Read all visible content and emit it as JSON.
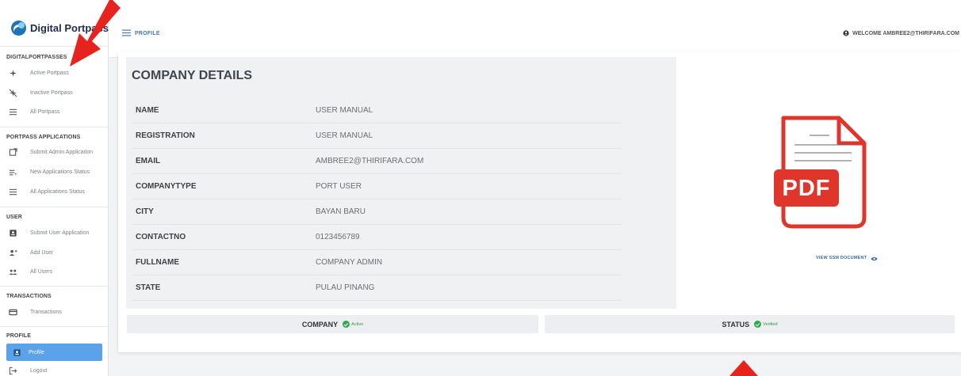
{
  "app": {
    "brand": "Digital Portpass",
    "brand_color": "#1f74b7"
  },
  "topbar": {
    "breadcrumb": "PROFILE",
    "welcome": "WELCOME AMBREE2@THIRIFARA.COM"
  },
  "sidebar": {
    "sections": [
      {
        "heading": "DIGITALPORTPASSES",
        "items": [
          {
            "label": "Active Portpass",
            "icon": "plane-icon"
          },
          {
            "label": "Inactive Portpass",
            "icon": "plane-off-icon"
          },
          {
            "label": "All Portpass",
            "icon": "list-icon"
          }
        ]
      },
      {
        "heading": "PORTPASS APPLICATIONS",
        "items": [
          {
            "label": "Submit Admin Application",
            "icon": "form-icon"
          },
          {
            "label": "New Applications Status",
            "icon": "new-list-icon"
          },
          {
            "label": "All Applications Status",
            "icon": "list-icon"
          }
        ]
      },
      {
        "heading": "USER",
        "items": [
          {
            "label": "Submit User Application",
            "icon": "id-badge-icon"
          },
          {
            "label": "Add User",
            "icon": "add-user-icon"
          },
          {
            "label": "All Users",
            "icon": "users-icon"
          }
        ]
      },
      {
        "heading": "TRANSACTIONS",
        "items": [
          {
            "label": "Transactions",
            "icon": "card-icon"
          }
        ]
      },
      {
        "heading": "PROFILE",
        "items": [
          {
            "label": "Profile",
            "icon": "profile-icon",
            "active": true
          },
          {
            "label": "Logout",
            "icon": "logout-icon"
          }
        ]
      }
    ],
    "active_color": "#5aa2ea"
  },
  "company_details": {
    "title": "COMPANY DETAILS",
    "rows": [
      {
        "key": "NAME",
        "value": "USER MANUAL"
      },
      {
        "key": "REGISTRATION",
        "value": "USER MANUAL"
      },
      {
        "key": "EMAIL",
        "value": "AMBREE2@THIRIFARA.COM"
      },
      {
        "key": "COMPANYTYPE",
        "value": "PORT USER"
      },
      {
        "key": "CITY",
        "value": "BAYAN BARU"
      },
      {
        "key": "CONTACTNO",
        "value": "0123456789"
      },
      {
        "key": "FULLNAME",
        "value": "COMPANY ADMIN"
      },
      {
        "key": "STATE",
        "value": "PULAU PINANG"
      }
    ]
  },
  "document": {
    "pdf_label": "PDF",
    "link_label": "VIEW SSM DOCUMENT",
    "pdf_color": "#e0352b"
  },
  "status": {
    "company_label": "COMPANY",
    "company_badge": "Active",
    "status_label": "STATUS",
    "status_badge": "Verified",
    "badge_color": "#2eaa4b"
  },
  "annotation_color": "#e8231d"
}
